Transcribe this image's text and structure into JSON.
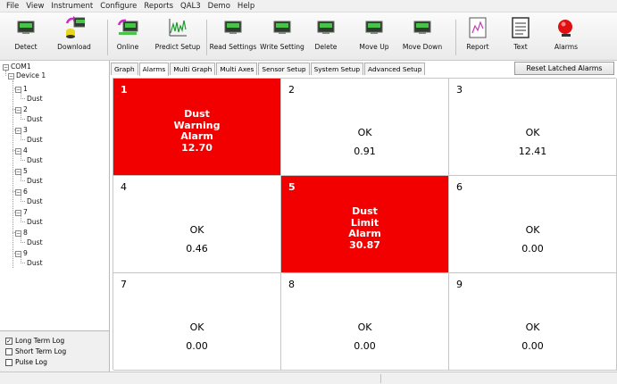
{
  "menu": [
    "File",
    "View",
    "Instrument",
    "Configure",
    "Reports",
    "QAL3",
    "Demo",
    "Help"
  ],
  "toolbar": {
    "detect": "Detect",
    "download": "Download",
    "online": "Online",
    "predict_setup": "Predict Setup",
    "read_settings": "Read Settings",
    "write_setting": "Write Setting",
    "delete": "Delete",
    "move_up": "Move Up",
    "move_down": "Move Down",
    "report": "Report",
    "text": "Text",
    "alarms": "Alarms"
  },
  "tree": {
    "root": "COM1",
    "device": "Device 1",
    "channels": [
      {
        "id": "1",
        "child": "Dust"
      },
      {
        "id": "2",
        "child": "Dust"
      },
      {
        "id": "3",
        "child": "Dust"
      },
      {
        "id": "4",
        "child": "Dust"
      },
      {
        "id": "5",
        "child": "Dust"
      },
      {
        "id": "6",
        "child": "Dust"
      },
      {
        "id": "7",
        "child": "Dust"
      },
      {
        "id": "8",
        "child": "Dust"
      },
      {
        "id": "9",
        "child": "Dust"
      }
    ]
  },
  "log_options": [
    {
      "label": "Long Term Log",
      "checked": true
    },
    {
      "label": "Short Term Log",
      "checked": false
    },
    {
      "label": "Pulse Log",
      "checked": false
    }
  ],
  "tabs": [
    "Graph",
    "Alarms",
    "Multi Graph",
    "Multi Axes",
    "Sensor Setup",
    "System Setup",
    "Advanced Setup"
  ],
  "active_tab": "Alarms",
  "reset_button": "Reset Latched Alarms",
  "alarm_color": "#f20000",
  "cells": [
    {
      "num": "1",
      "alarm": true,
      "lines": [
        "Dust",
        "Warning",
        "Alarm",
        "12.70"
      ]
    },
    {
      "num": "2",
      "alarm": false,
      "status": "OK",
      "value": "0.91"
    },
    {
      "num": "3",
      "alarm": false,
      "status": "OK",
      "value": "12.41"
    },
    {
      "num": "4",
      "alarm": false,
      "status": "OK",
      "value": "0.46"
    },
    {
      "num": "5",
      "alarm": true,
      "lines": [
        "Dust",
        "Limit",
        "Alarm",
        "30.87"
      ]
    },
    {
      "num": "6",
      "alarm": false,
      "status": "OK",
      "value": "0.00"
    },
    {
      "num": "7",
      "alarm": false,
      "status": "OK",
      "value": "0.00"
    },
    {
      "num": "8",
      "alarm": false,
      "status": "OK",
      "value": "0.00"
    },
    {
      "num": "9",
      "alarm": false,
      "status": "OK",
      "value": "0.00"
    }
  ]
}
